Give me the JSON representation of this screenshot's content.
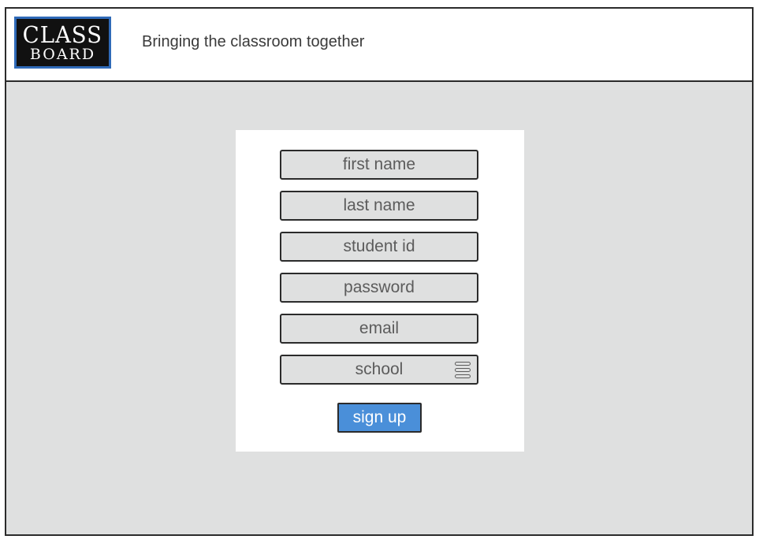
{
  "header": {
    "logo": {
      "line1": "CLASS",
      "line2": "BOARD"
    },
    "tagline": "Bringing the classroom together"
  },
  "form": {
    "fields": [
      {
        "placeholder": "first name"
      },
      {
        "placeholder": "last name"
      },
      {
        "placeholder": "student id"
      },
      {
        "placeholder": "password"
      },
      {
        "placeholder": "email"
      }
    ],
    "school_select": {
      "value": "school",
      "icon": "list-icon"
    },
    "submit_label": "sign up"
  },
  "colors": {
    "background": "#dfe0e0",
    "card": "#ffffff",
    "accent": "#4a8fd9",
    "logo_border": "#2f6ab8",
    "border": "#2b2b2b"
  }
}
